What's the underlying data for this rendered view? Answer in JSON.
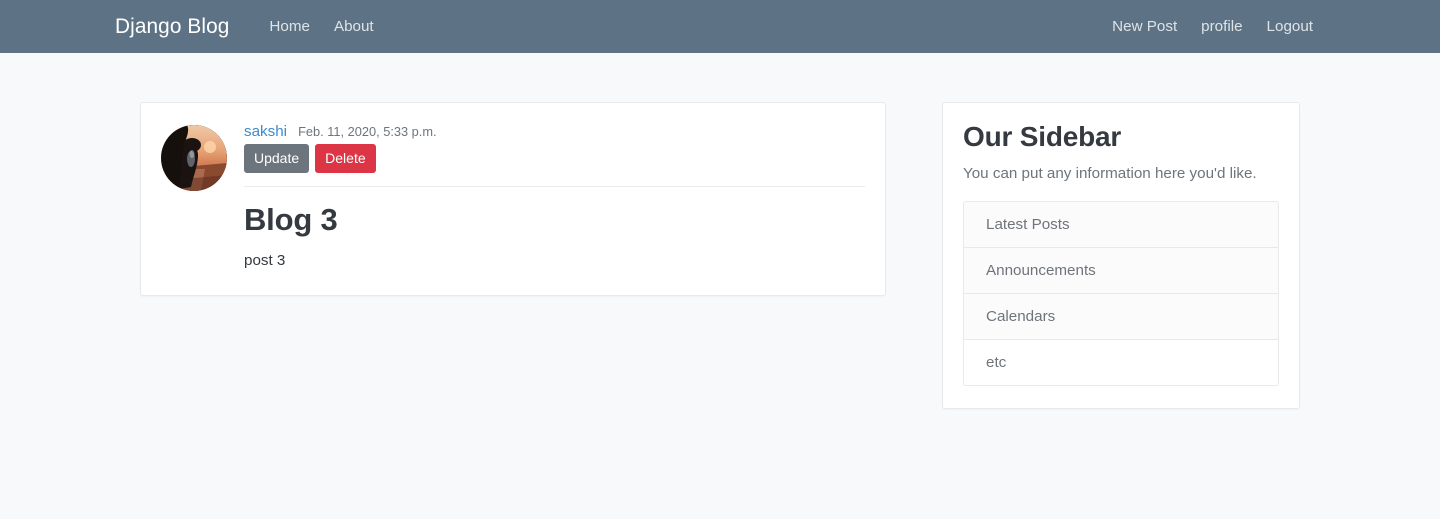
{
  "navbar": {
    "brand": "Django Blog",
    "left_links": [
      {
        "label": "Home",
        "name": "nav-link-home"
      },
      {
        "label": "About",
        "name": "nav-link-about"
      }
    ],
    "right_links": [
      {
        "label": "New Post",
        "name": "nav-link-new-post"
      },
      {
        "label": "profile",
        "name": "nav-link-profile"
      },
      {
        "label": "Logout",
        "name": "nav-link-logout"
      }
    ],
    "background_color": "#5d7385",
    "brand_color": "#ffffff",
    "link_color": "rgba(255,255,255,0.80)"
  },
  "post": {
    "author": "sakshi",
    "date": "Feb. 11, 2020, 5:33 p.m.",
    "title": "Blog 3",
    "content": "post 3",
    "avatar_alt": "user-avatar",
    "buttons": {
      "update": "Update",
      "delete": "Delete"
    },
    "author_link_color": "#3d8bcd",
    "update_button_color": "#6c757d",
    "delete_button_color": "#dc3545"
  },
  "sidebar": {
    "title": "Our Sidebar",
    "description": "You can put any information here you'd like.",
    "items": [
      {
        "label": "Latest Posts"
      },
      {
        "label": "Announcements"
      },
      {
        "label": "Calendars"
      },
      {
        "label": "etc"
      }
    ]
  },
  "page": {
    "background_color": "#f8f9fa",
    "card_background": "#ffffff",
    "card_border_color": "#e7e9eb"
  }
}
